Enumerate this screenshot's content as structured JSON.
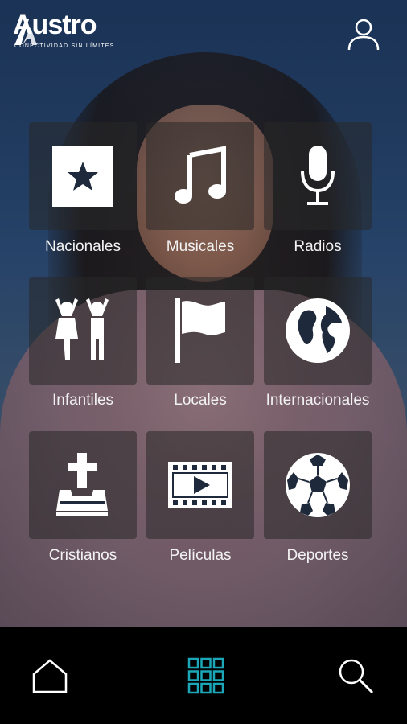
{
  "header": {
    "logo_text": "Austro",
    "logo_tagline": "CONECTIVIDAD SIN LÍMITES",
    "profile_icon": "user-icon"
  },
  "categories": [
    {
      "label": "Nacionales",
      "icon": "star-icon"
    },
    {
      "label": "Musicales",
      "icon": "music-note-icon"
    },
    {
      "label": "Radios",
      "icon": "microphone-icon"
    },
    {
      "label": "Infantiles",
      "icon": "children-icon"
    },
    {
      "label": "Locales",
      "icon": "flag-icon"
    },
    {
      "label": "Internacionales",
      "icon": "globe-icon"
    },
    {
      "label": "Cristianos",
      "icon": "bible-cross-icon"
    },
    {
      "label": "Películas",
      "icon": "film-strip-icon"
    },
    {
      "label": "Deportes",
      "icon": "soccer-ball-icon"
    }
  ],
  "bottom_nav": {
    "items": [
      {
        "name": "home",
        "icon": "home-icon",
        "active": false
      },
      {
        "name": "grid",
        "icon": "grid-icon",
        "active": true
      },
      {
        "name": "search",
        "icon": "search-icon",
        "active": false
      }
    ],
    "active_color": "#1ba7b8",
    "inactive_color": "#ffffff"
  },
  "colors": {
    "background_top": "#1f3b63",
    "tile_overlay": "rgba(40,40,40,0.55)",
    "nav_background": "#000000"
  }
}
